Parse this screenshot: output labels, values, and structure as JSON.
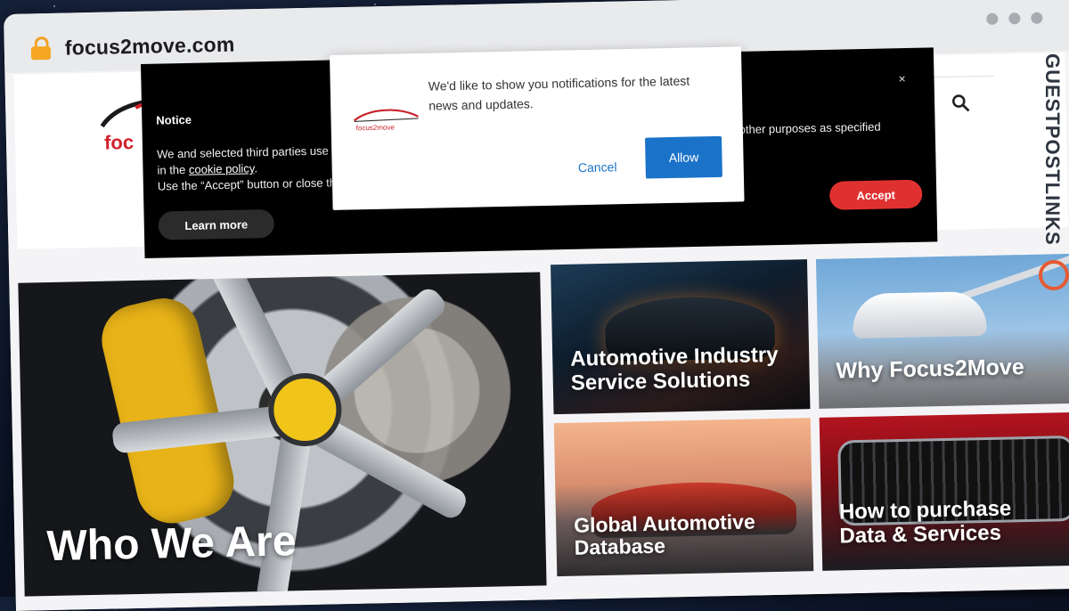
{
  "browser": {
    "url": "focus2move.com"
  },
  "site": {
    "logo_text": "foc"
  },
  "tiles": [
    {
      "label": "Who We Are"
    },
    {
      "label": "Automotive Industry Service Solutions"
    },
    {
      "label": "Why Focus2Move"
    },
    {
      "label": "Global Automotive Database"
    },
    {
      "label": "How to purchase Data & Services"
    }
  ],
  "side_brand": {
    "text": "GUESTPOSTLINKS"
  },
  "cookie_notice": {
    "title": "Notice",
    "line1_left": "We and selected third parties use c",
    "line1_right": "other purposes as specified",
    "line2_prefix": "in the ",
    "policy_link": "cookie policy",
    "line2_suffix": ".",
    "line3": "Use the “Accept” button or close th",
    "learn_more": "Learn more",
    "accept": "Accept",
    "close": "×"
  },
  "notification_prompt": {
    "logo_text": "focus2move",
    "message": "We'd like to show you notifications for the latest news and updates.",
    "cancel": "Cancel",
    "allow": "Allow"
  },
  "colors": {
    "accent_red": "#e03131",
    "allow_blue": "#1a73c8",
    "lock": "#f5a623",
    "brand_red": "#d21f2a"
  }
}
